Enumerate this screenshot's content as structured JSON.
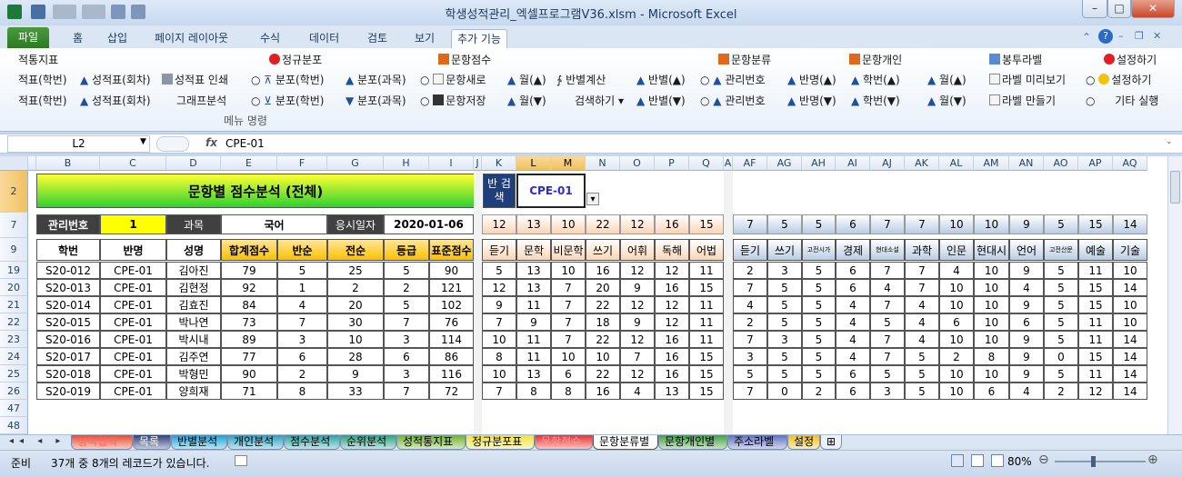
{
  "window": {
    "title": "학생성적관리_엑셀프로그램V36.xlsm  -  Microsoft Excel"
  },
  "tabs": [
    "파일",
    "홈",
    "삽입",
    "페이지 레이아웃",
    "수식",
    "데이터",
    "검토",
    "보기",
    "추가 기능"
  ],
  "ribbon": {
    "r1": [
      "적통지표",
      "정규분포",
      "문항점수",
      "문항분류",
      "문항개인",
      "봉투라벨",
      "설정하기"
    ],
    "r2": [
      "적표(학번)",
      "성적표(회차)",
      "성적표 인쇄",
      "분포(학번)",
      "분포(과목)",
      "문항새로",
      "월(▲)",
      "반별계산",
      "반별(▲)",
      "관리번호",
      "반명(▲)",
      "학번(▲)",
      "월(▲)",
      "라벨 미리보기",
      "설정하기"
    ],
    "r3": [
      "적표(학번)",
      "성적표(회차)",
      "그래프분석",
      "분포(학번)",
      "분포(과목)",
      "문항저장",
      "월(▼)",
      "검색하기",
      "반별(▼)",
      "관리번호",
      "반명(▼)",
      "학번(▼)",
      "월(▼)",
      "라벨 만들기",
      "기타 실행"
    ],
    "group_label": "메뉴 명령"
  },
  "formula_bar": {
    "name_box": "L2",
    "fx": "fx",
    "value": "CPE-01"
  },
  "columns": [
    "B",
    "C",
    "D",
    "E",
    "F",
    "G",
    "H",
    "I",
    "J",
    "K",
    "L",
    "M",
    "N",
    "O",
    "P",
    "Q",
    "A",
    "AF",
    "AG",
    "AH",
    "AI",
    "AJ",
    "AK",
    "AL",
    "AM",
    "AN",
    "AO",
    "AP",
    "AQ"
  ],
  "row_numbers": [
    "2",
    "7",
    "9",
    "19",
    "20",
    "21",
    "22",
    "23",
    "24",
    "25",
    "26",
    "47",
    "48"
  ],
  "sheet": {
    "title": "문항별 점수분석 (전체)",
    "search_label": "반 검색",
    "search_value": "CPE-01",
    "info": {
      "mgmt_label": "관리번호",
      "mgmt_value": "1",
      "subject_label": "과목",
      "subject_value": "국어",
      "date_label": "응시일자",
      "date_value": "2020-01-06"
    },
    "mid_top": [
      "12",
      "13",
      "10",
      "22",
      "12",
      "16",
      "15"
    ],
    "right_top": [
      "7",
      "5",
      "5",
      "6",
      "7",
      "7",
      "10",
      "10",
      "9",
      "5",
      "15",
      "14"
    ],
    "headers_left": [
      "학번",
      "반명",
      "성명",
      "합계점수",
      "반순",
      "전순",
      "등급",
      "표준점수"
    ],
    "headers_mid": [
      "듣기",
      "문학",
      "비문학",
      "쓰기",
      "어휘",
      "독해",
      "어법"
    ],
    "headers_right": [
      "듣기",
      "쓰기",
      "고전시가",
      "경제",
      "현대소설",
      "과학",
      "인문",
      "현대시",
      "언어",
      "고전산문",
      "예술",
      "기술"
    ],
    "rows": [
      {
        "id": "S20-012",
        "cls": "CPE-01",
        "name": "김아진",
        "total": "79",
        "r1": "5",
        "r2": "25",
        "grade": "5",
        "std": "90",
        "mid": [
          "5",
          "13",
          "10",
          "16",
          "12",
          "12",
          "11"
        ],
        "right": [
          "2",
          "3",
          "5",
          "6",
          "7",
          "7",
          "4",
          "10",
          "9",
          "5",
          "11",
          "10"
        ]
      },
      {
        "id": "S20-013",
        "cls": "CPE-01",
        "name": "김현정",
        "total": "92",
        "r1": "1",
        "r2": "2",
        "grade": "2",
        "std": "121",
        "mid": [
          "12",
          "13",
          "7",
          "20",
          "9",
          "16",
          "15"
        ],
        "right": [
          "7",
          "5",
          "5",
          "6",
          "4",
          "7",
          "10",
          "10",
          "4",
          "5",
          "15",
          "14"
        ]
      },
      {
        "id": "S20-014",
        "cls": "CPE-01",
        "name": "김효진",
        "total": "84",
        "r1": "4",
        "r2": "20",
        "grade": "5",
        "std": "102",
        "mid": [
          "9",
          "11",
          "7",
          "22",
          "12",
          "12",
          "11"
        ],
        "right": [
          "4",
          "5",
          "5",
          "4",
          "7",
          "4",
          "10",
          "10",
          "9",
          "5",
          "15",
          "10"
        ]
      },
      {
        "id": "S20-015",
        "cls": "CPE-01",
        "name": "박나연",
        "total": "73",
        "r1": "7",
        "r2": "30",
        "grade": "7",
        "std": "76",
        "mid": [
          "7",
          "9",
          "7",
          "18",
          "9",
          "12",
          "11"
        ],
        "right": [
          "2",
          "5",
          "5",
          "4",
          "5",
          "4",
          "6",
          "10",
          "6",
          "5",
          "11",
          "10"
        ]
      },
      {
        "id": "S20-016",
        "cls": "CPE-01",
        "name": "박시내",
        "total": "89",
        "r1": "3",
        "r2": "10",
        "grade": "3",
        "std": "114",
        "mid": [
          "10",
          "11",
          "7",
          "22",
          "12",
          "16",
          "11"
        ],
        "right": [
          "7",
          "3",
          "5",
          "4",
          "7",
          "4",
          "10",
          "10",
          "9",
          "5",
          "11",
          "14"
        ]
      },
      {
        "id": "S20-017",
        "cls": "CPE-01",
        "name": "김주연",
        "total": "77",
        "r1": "6",
        "r2": "28",
        "grade": "6",
        "std": "86",
        "mid": [
          "8",
          "11",
          "10",
          "10",
          "7",
          "16",
          "15"
        ],
        "right": [
          "3",
          "5",
          "5",
          "4",
          "7",
          "5",
          "2",
          "8",
          "9",
          "0",
          "15",
          "14"
        ]
      },
      {
        "id": "S20-018",
        "cls": "CPE-01",
        "name": "박형민",
        "total": "90",
        "r1": "2",
        "r2": "9",
        "grade": "3",
        "std": "116",
        "mid": [
          "10",
          "13",
          "6",
          "22",
          "12",
          "16",
          "15"
        ],
        "right": [
          "5",
          "5",
          "5",
          "6",
          "5",
          "5",
          "10",
          "10",
          "9",
          "5",
          "11",
          "14"
        ]
      },
      {
        "id": "S20-019",
        "cls": "CPE-01",
        "name": "양희재",
        "total": "71",
        "r1": "8",
        "r2": "33",
        "grade": "7",
        "std": "72",
        "mid": [
          "7",
          "8",
          "8",
          "16",
          "4",
          "13",
          "15"
        ],
        "right": [
          "7",
          "0",
          "2",
          "6",
          "3",
          "5",
          "10",
          "6",
          "4",
          "2",
          "12",
          "14"
        ]
      }
    ]
  },
  "sheet_tabs": [
    "성적입력",
    "목록",
    "반별분석",
    "개인분석",
    "점수분석",
    "순위분석",
    "성적통지표",
    "정규분포표",
    "문항점수",
    "문항분류별",
    "문항개인별",
    "주소라벨",
    "설정"
  ],
  "status": {
    "ready": "준비",
    "records": "37개 중 8개의 레코드가 있습니다.",
    "zoom": "80%"
  },
  "colors": {
    "title_grad": "#2fd12f",
    "accent_yellow": "#ffff00",
    "header_orange": "#ffc000",
    "header_peach": "#fcd5b4",
    "header_blue": "#b8cce4",
    "dark_label": "#404040"
  }
}
